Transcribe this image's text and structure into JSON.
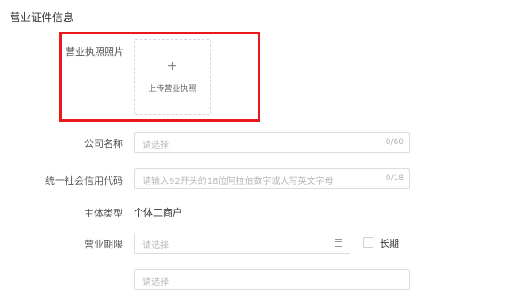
{
  "section": {
    "title": "营业证件信息"
  },
  "license_photo": {
    "label": "营业执照照片",
    "upload_icon": "plus-icon",
    "upload_glyph": "+",
    "upload_text": "上传营业执照"
  },
  "company_name": {
    "label": "公司名称",
    "placeholder": "请选择",
    "counter": "0/60"
  },
  "credit_code": {
    "label": "统一社会信用代码",
    "placeholder": "请输入92开头的18位阿拉伯数字或大写英文字母",
    "counter": "0/18"
  },
  "entity_type": {
    "label": "主体类型",
    "value": "个体工商户"
  },
  "business_term": {
    "label": "营业期限",
    "placeholder": "请选择",
    "icon": "calendar-icon",
    "long_term_label": "长期"
  },
  "partial_row": {
    "placeholder": "请选择"
  },
  "colors": {
    "highlight": "#e8191c",
    "border": "#dcdcdc",
    "placeholder": "#b8b8b8"
  }
}
